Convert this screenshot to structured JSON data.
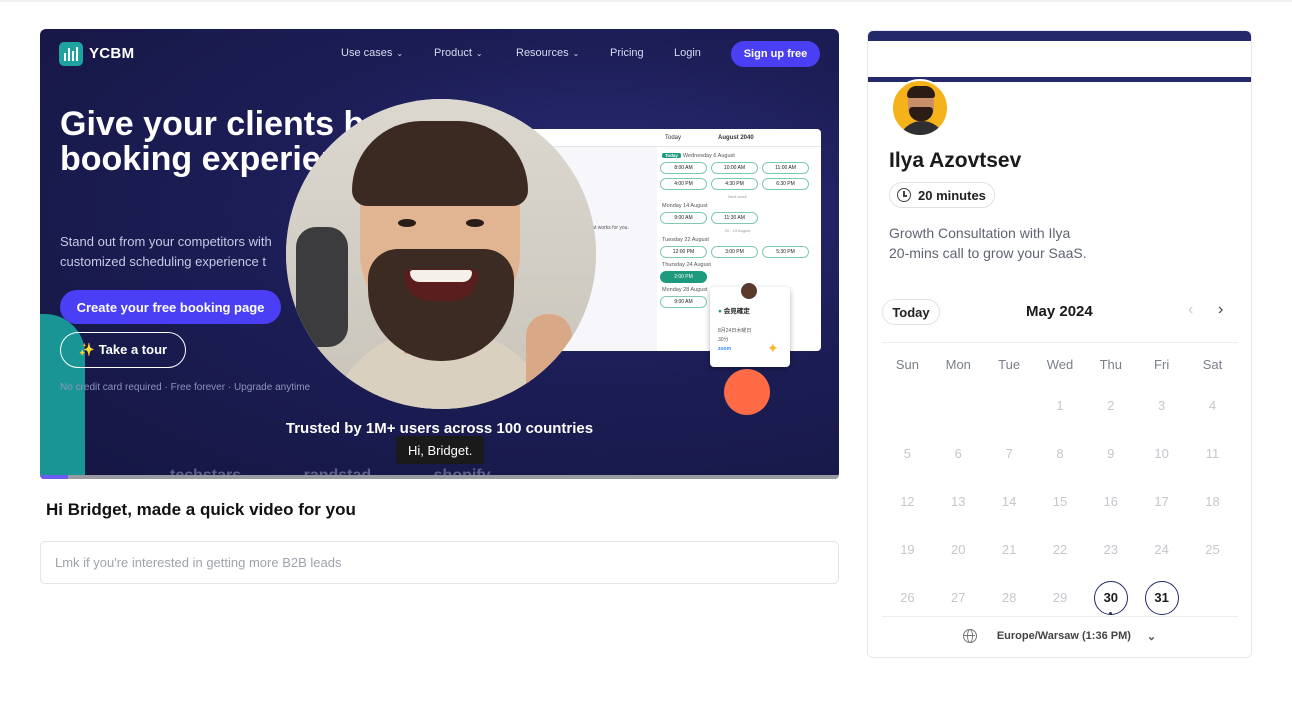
{
  "video": {
    "brand": "YCBM",
    "nav": [
      {
        "label": "Use cases",
        "chevron": true
      },
      {
        "label": "Product",
        "chevron": true
      },
      {
        "label": "Resources",
        "chevron": true
      },
      {
        "label": "Pricing",
        "chevron": false
      },
      {
        "label": "Login",
        "chevron": false
      }
    ],
    "signup_label": "Sign up free",
    "headline": "Give your clients better booking experience",
    "subheadline": "Stand out from your competitors with customized scheduling experience t",
    "cta_label": "Create your free booking page",
    "tour_label": "✨ Take a tour",
    "fineprint": "No credit card required  · Free forever  · Upgrade anytime",
    "trusted": "Trusted by 1M+ users across 100 countries",
    "logos": [
      "techstars",
      "randstad",
      "",
      "shopify"
    ],
    "mock": {
      "header_left": "Today",
      "header_month": "August 2040",
      "left_title": "n",
      "left_sub": "that works for you.",
      "groups": [
        {
          "day": "Wednesday 6 August",
          "badge": "Today",
          "slots": [
            [
              "8:00 AM",
              "10:00 AM",
              "11:00 AM"
            ],
            [
              "4:00 PM",
              "4:30 PM",
              "6:30 PM"
            ]
          ],
          "more": "Next week"
        },
        {
          "day": "Monday 14 August",
          "badge": "",
          "slots": [
            [
              "9:00 AM",
              "11:30 AM"
            ]
          ],
          "more": "20 - 23 August"
        },
        {
          "day": "Tuesday 22 August",
          "badge": "",
          "slots": [
            [
              "12:00 PM",
              "3:00 PM",
              "5:30 PM"
            ]
          ],
          "more": ""
        },
        {
          "day": "Thursday 24 August",
          "badge": "",
          "slots": [
            [
              "2:00 PM"
            ]
          ],
          "more": ""
        },
        {
          "day": "Monday 28 August",
          "badge": "",
          "slots": [
            [
              "9:00 AM"
            ]
          ],
          "more": ""
        }
      ],
      "popup_title": "会見確定",
      "popup_date": "8月24日木曜日",
      "popup_duration": "30分",
      "popup_provider": "zoom"
    },
    "caption": "Hi, Bridget.",
    "progress": 0.035,
    "accent": "#4a3ff5"
  },
  "message": {
    "title": "Hi Bridget, made a quick video for you",
    "reply_placeholder": "Lmk if you're interested in getting more B2B leads"
  },
  "booking": {
    "host_name": "Ilya Azovtsev",
    "duration": "20 minutes",
    "description_line1": "Growth Consultation with Ilya",
    "description_line2": "20-mins call to grow your SaaS.",
    "today_label": "Today",
    "month_label": "May 2024",
    "weekdays": [
      "Sun",
      "Mon",
      "Tue",
      "Wed",
      "Thu",
      "Fri",
      "Sat"
    ],
    "leading_blanks": 3,
    "days": [
      1,
      2,
      3,
      4,
      5,
      6,
      7,
      8,
      9,
      10,
      11,
      12,
      13,
      14,
      15,
      16,
      17,
      18,
      19,
      20,
      21,
      22,
      23,
      24,
      25,
      26,
      27,
      28,
      29,
      30,
      31
    ],
    "available_days": [
      30,
      31
    ],
    "today_day": 30,
    "timezone": "Europe/Warsaw (1:36 PM)",
    "brand_color": "#24296b"
  }
}
